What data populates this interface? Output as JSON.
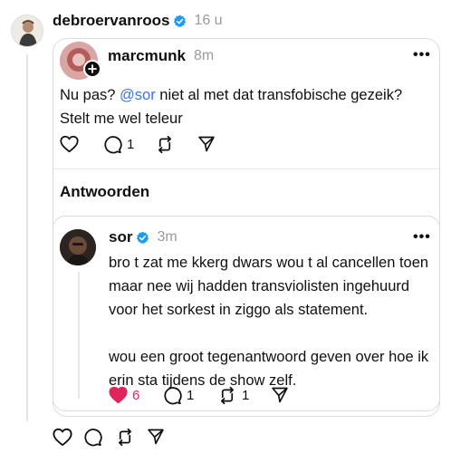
{
  "top_post": {
    "username": "debroervanroos",
    "time": "16 u"
  },
  "quoted_post": {
    "username": "marcmunk",
    "time": "8m",
    "text_before": "Nu pas? ",
    "mention": "@sor",
    "text_after": " niet al met dat transfobische gezeik? Stelt me wel teleur",
    "reply_count": "1",
    "more": "•••"
  },
  "replies_heading": "Antwoorden",
  "reply_post": {
    "username": "sor",
    "time": "3m",
    "paragraph1": "bro t zat me kkerg dwars wou t al cancellen toen maar nee wij hadden transviolisten ingehuurd voor het sorkest in ziggo als statement.",
    "paragraph2": "wou een groot tegenantwoord geven over hoe ik erin sta tijdens de show zelf.",
    "like_count": "6",
    "reply_count": "1",
    "repost_count": "1",
    "more": "•••"
  },
  "colors": {
    "verified": "#1d9bf0",
    "liked": "#e0245e",
    "mention": "#3d74e0"
  }
}
